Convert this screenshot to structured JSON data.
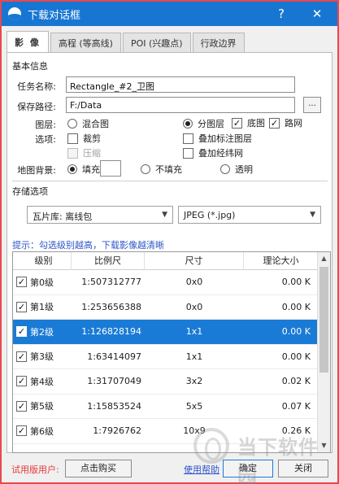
{
  "window": {
    "title": "下载对话框",
    "help": "?",
    "close": "✕"
  },
  "tabs": [
    "影 像",
    "高程 (等高线)",
    "POI (兴趣点)",
    "行政边界"
  ],
  "basic": {
    "group_title": "基本信息",
    "task_label": "任务名称:",
    "task_value": "Rectangle_#2_卫图",
    "path_label": "保存路径:",
    "path_value": "F:/Data",
    "browse": "...",
    "layer_label": "图层:",
    "layer_mixed": "混合图",
    "layer_split": "分图层",
    "layer_base": "底图",
    "layer_road": "路网",
    "option_label": "选项:",
    "opt_clip": "裁剪",
    "opt_overlay_label": "叠加标注图层",
    "opt_compress": "压缩",
    "opt_grid": "叠加经纬网",
    "bg_label": "地图背景:",
    "bg_fill": "填充",
    "bg_nofill": "不填充",
    "bg_transparent": "透明"
  },
  "storage": {
    "group_title": "存储选项",
    "tile_lib": "瓦片库: 离线包",
    "format": "JPEG (*.jpg)"
  },
  "hint": "提示：勾选级别越高，下载影像越清晰",
  "table": {
    "headers": [
      "级别",
      "比例尺",
      "尺寸",
      "理论大小"
    ],
    "rows": [
      {
        "level": "第0级",
        "scale": "1:507312777",
        "size": "0x0",
        "est": "0.00 K",
        "checked": true,
        "selected": false
      },
      {
        "level": "第1级",
        "scale": "1:253656388",
        "size": "0x0",
        "est": "0.00 K",
        "checked": true,
        "selected": false
      },
      {
        "level": "第2级",
        "scale": "1:126828194",
        "size": "1x1",
        "est": "0.00 K",
        "checked": true,
        "selected": true
      },
      {
        "level": "第3级",
        "scale": "1:63414097",
        "size": "1x1",
        "est": "0.00 K",
        "checked": true,
        "selected": false
      },
      {
        "level": "第4级",
        "scale": "1:31707049",
        "size": "3x2",
        "est": "0.02 K",
        "checked": true,
        "selected": false
      },
      {
        "level": "第5级",
        "scale": "1:15853524",
        "size": "5x5",
        "est": "0.07 K",
        "checked": true,
        "selected": false
      },
      {
        "level": "第6级",
        "scale": "1:7926762",
        "size": "10x9",
        "est": "0.26 K",
        "checked": true,
        "selected": false
      }
    ]
  },
  "footer": {
    "trial_label": "试用版用户:",
    "buy": "点击购买",
    "help_link": "使用帮助",
    "ok": "确定",
    "close": "关闭"
  },
  "watermark": "当下软件园",
  "colors": {
    "titlebar": "#1876d3",
    "selected_row": "#1a7bd6",
    "hint": "#2f55c8",
    "trial": "#e5383b"
  }
}
